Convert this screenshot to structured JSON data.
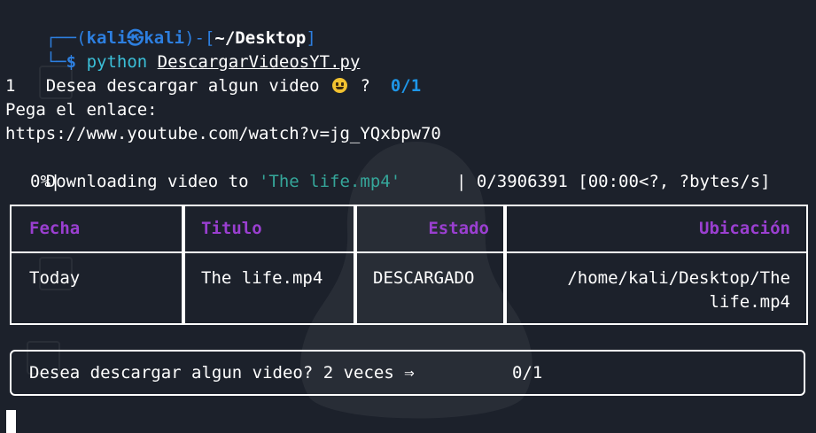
{
  "prompt": {
    "user": "kali",
    "host": "kali",
    "skull_glyph": "㉿",
    "path": "~/Desktop",
    "dollar": "$",
    "command": "python",
    "script": "DescargarVideosYT.py"
  },
  "output": {
    "question": "Desea descargar algun video",
    "question_suffix": " ?  ",
    "counter": "0/1",
    "answer": "1",
    "paste_prompt": "Pega el enlace:",
    "url": "https://www.youtube.com/watch?v=jg_YQxbpw70",
    "downloading_prefix": "Downloading video to ",
    "downloading_file": "'The life.mp4'",
    "progress_percent": "0%|",
    "progress_stats": "| 0/3906391 [00:00<?, ?bytes/s]",
    "progress_fraction": 0
  },
  "table": {
    "headers": [
      "Fecha",
      "Titulo",
      "Estado",
      "Ubicación"
    ],
    "row": {
      "fecha": "Today",
      "titulo": "The life.mp4",
      "estado": "DESCARGADO",
      "ubicacion_line1": "/home/kali/Desktop/The",
      "ubicacion_line2": "life.mp4"
    }
  },
  "panel": {
    "text": "Desea descargar algun video? 2 veces ⇒",
    "count": "0/1"
  },
  "colors": {
    "background": "#1c212b",
    "prompt_blue": "#2d7fe0",
    "command_cyan": "#3bbfd8",
    "header_purple": "#9a3fd0",
    "filename_teal": "#35a69a"
  },
  "icons": {
    "emoji": "smiling-face-icon",
    "cursor": "terminal-cursor"
  }
}
